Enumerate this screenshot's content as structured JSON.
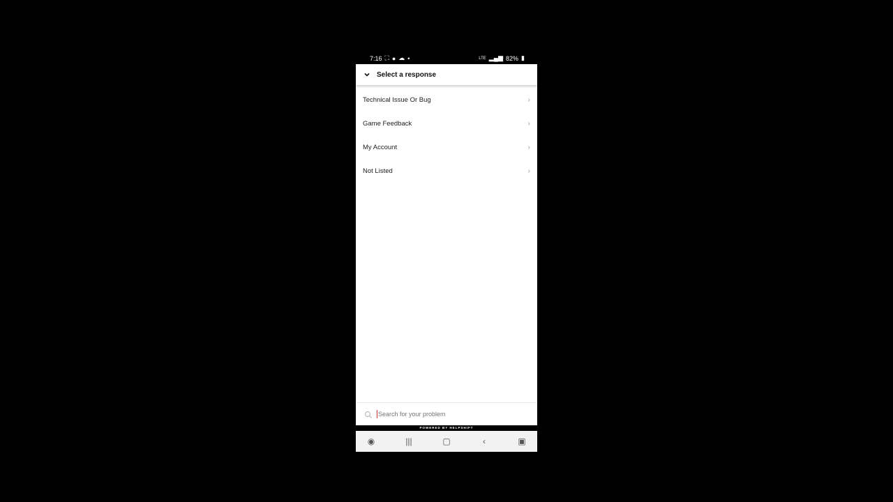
{
  "status_bar": {
    "time": "7:16",
    "battery": "82%"
  },
  "header": {
    "title": "Select a response"
  },
  "items": [
    {
      "label": "Technical Issue Or Bug"
    },
    {
      "label": "Game Feedback"
    },
    {
      "label": "My Account"
    },
    {
      "label": "Not Listed"
    }
  ],
  "search": {
    "placeholder": "Search for your problem"
  },
  "footer": {
    "powered_by": "POWERED BY HELPSHIFT"
  }
}
